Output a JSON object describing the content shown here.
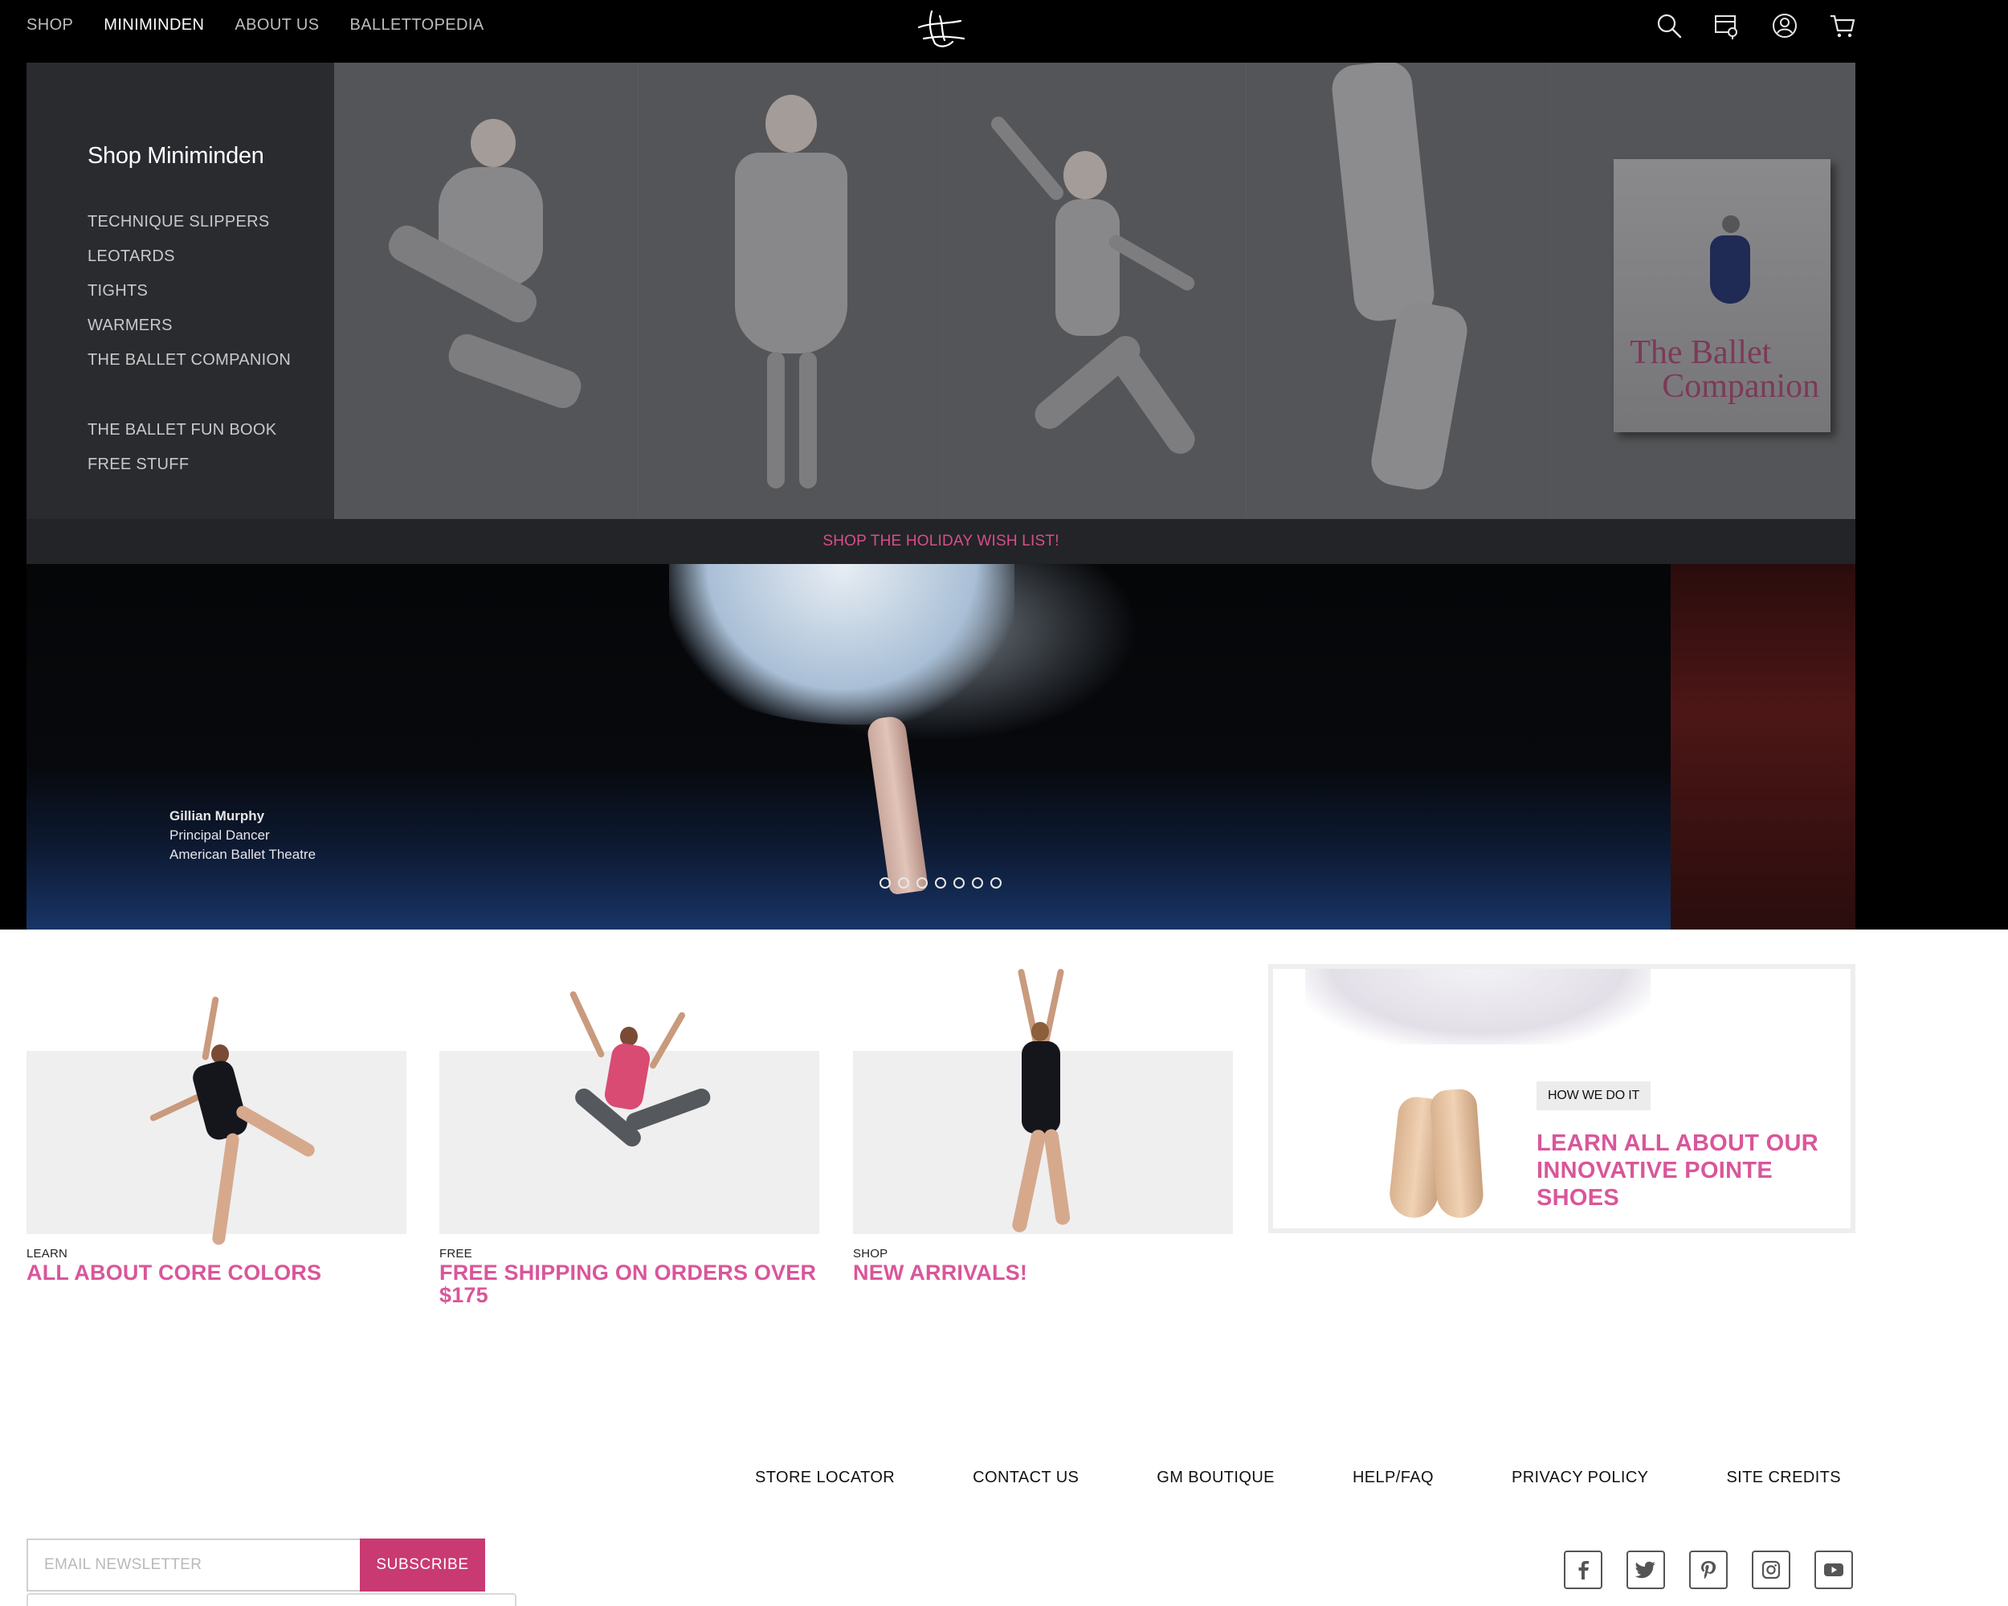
{
  "nav": {
    "items": [
      {
        "label": "SHOP",
        "active": false
      },
      {
        "label": "MINIMINDEN",
        "active": true
      },
      {
        "label": "ABOUT US",
        "active": false
      },
      {
        "label": "BALLETTOPEDIA",
        "active": false
      }
    ],
    "icons": [
      "search-icon",
      "store-locator-icon",
      "account-icon",
      "cart-icon"
    ]
  },
  "mega_menu": {
    "title": "Shop Miniminden",
    "items": [
      "TECHNIQUE SLIPPERS",
      "LEOTARDS",
      "TIGHTS",
      "WARMERS",
      "THE BALLET COMPANION"
    ],
    "extra_items": [
      "THE BALLET FUN BOOK",
      "FREE STUFF"
    ],
    "tiles": [
      {
        "name": "technique-slippers"
      },
      {
        "name": "leotards"
      },
      {
        "name": "tights"
      },
      {
        "name": "warmers"
      },
      {
        "name": "the-ballet-companion",
        "book_title": "The Ballet",
        "book_subtitle": "Companion"
      }
    ],
    "footer_link": "SHOP THE HOLIDAY WISH LIST!"
  },
  "hero": {
    "caption": {
      "name": "Gillian Murphy",
      "role": "Principal Dancer",
      "company": "American Ballet Theatre"
    },
    "slide_count": 7
  },
  "promos": [
    {
      "kicker": "LEARN",
      "title": "ALL ABOUT CORE COLORS"
    },
    {
      "kicker": "FREE",
      "title": "FREE SHIPPING ON ORDERS OVER $175"
    },
    {
      "kicker": "SHOP",
      "title": "NEW ARRIVALS!"
    }
  ],
  "pointe_card": {
    "tag": "HOW WE DO IT",
    "title": "LEARN ALL ABOUT OUR INNOVATIVE POINTE SHOES"
  },
  "footer": {
    "links": [
      "STORE LOCATOR",
      "CONTACT US",
      "GM BOUTIQUE",
      "HELP/FAQ",
      "PRIVACY POLICY",
      "SITE CREDITS"
    ],
    "newsletter": {
      "placeholder": "EMAIL NEWSLETTER",
      "button": "SUBSCRIBE"
    },
    "social": [
      "facebook-icon",
      "twitter-icon",
      "pinterest-icon",
      "instagram-icon",
      "youtube-icon"
    ]
  },
  "colors": {
    "accent": "#d9569a",
    "button": "#c93a72",
    "menu_bg": "#27282c"
  }
}
